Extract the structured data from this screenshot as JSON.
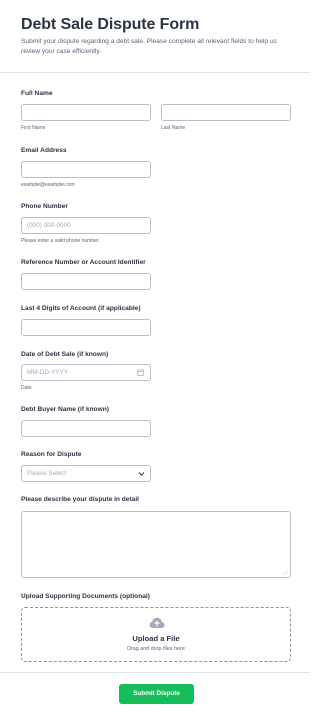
{
  "form": {
    "title": "Debt Sale Dispute Form",
    "subtitle": "Submit your dispute regarding a debt sale. Please complete all relevant fields to help us review your case efficiently."
  },
  "full_name": {
    "label": "Full Name",
    "first_sublabel": "First Name",
    "last_sublabel": "Last Name",
    "first_value": "",
    "last_value": ""
  },
  "email": {
    "label": "Email Address",
    "value": "",
    "sublabel": "example@example.com"
  },
  "phone": {
    "label": "Phone Number",
    "placeholder": "(000) 000-0000",
    "sublabel": "Please enter a valid phone number."
  },
  "reference": {
    "label": "Reference Number or Account Identifier",
    "value": ""
  },
  "last4": {
    "label": "Last 4 Digits of Account (if applicable)",
    "value": ""
  },
  "sale_date": {
    "label": "Date of Debt Sale (if known)",
    "placeholder": "MM-DD-YYYY",
    "sublabel": "Date",
    "icon": "calendar-icon"
  },
  "buyer": {
    "label": "Debt Buyer Name (if known)",
    "value": ""
  },
  "reason": {
    "label": "Reason for Dispute",
    "selected": "Please Select",
    "icon": "chevron-down-icon"
  },
  "description": {
    "label": "Please describe your dispute in detail",
    "value": ""
  },
  "upload": {
    "label": "Upload Supporting Documents (optional)",
    "title": "Upload a File",
    "subtitle": "Drag and drop files here",
    "icon": "cloud-upload-icon"
  },
  "submit": {
    "label": "Submit Dispute",
    "color": "#18bd5b"
  }
}
